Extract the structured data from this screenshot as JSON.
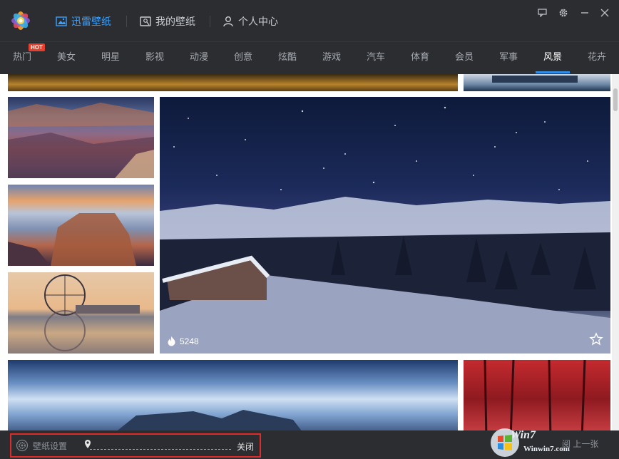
{
  "app": {
    "nav_tabs": [
      {
        "label": "迅雷壁纸",
        "icon": "image-icon"
      },
      {
        "label": "我的壁纸",
        "icon": "portrait-icon"
      },
      {
        "label": "个人中心",
        "icon": "user-icon"
      }
    ],
    "window_buttons": [
      "feedback-icon",
      "gear-icon",
      "minimize-icon",
      "close-icon"
    ]
  },
  "categories": {
    "items": [
      "热门",
      "美女",
      "明星",
      "影视",
      "动漫",
      "创意",
      "炫酷",
      "游戏",
      "汽车",
      "体育",
      "会员",
      "军事",
      "风景",
      "花卉"
    ],
    "active": "风景",
    "hot_badge": "HOT"
  },
  "featured": {
    "hot_count": "5248"
  },
  "bottom": {
    "settings_label": "壁纸设置",
    "close_label": "关闭",
    "prev_next_label": "阅 上一张"
  },
  "watermark": {
    "brand": "Win7",
    "url": "Winwin7.com"
  },
  "colors": {
    "accent": "#3aa1ff",
    "active_underline": "#2f8fe8",
    "highlight_box": "#e02b2b",
    "hot_badge": "#e5402d"
  }
}
